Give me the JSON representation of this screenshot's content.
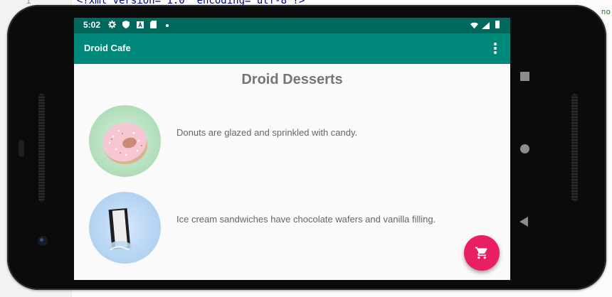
{
  "ide": {
    "line_number": "1",
    "code_line": "<?xml version=\"1.0\" encoding=\"utf-8\"?>",
    "right_fragments": [
      "no",
      "",
      ""
    ]
  },
  "status_bar": {
    "time": "5:02",
    "icons": [
      "gear-icon",
      "shield-icon",
      "a-icon",
      "sd-card-icon",
      "dot-icon",
      "wifi-icon",
      "signal-icon",
      "battery-icon"
    ]
  },
  "app_bar": {
    "title": "Droid Cafe",
    "overflow_icon": "more-vert-icon"
  },
  "main": {
    "heading": "Droid Desserts",
    "items": [
      {
        "image": "donut",
        "description": "Donuts are glazed and sprinkled with candy."
      },
      {
        "image": "ice-cream-sandwich",
        "description": "Ice cream sandwiches have chocolate wafers and vanilla filling."
      }
    ]
  },
  "fab": {
    "icon": "shopping-cart-icon"
  },
  "navigation": [
    "recents-square-icon",
    "home-circle-icon",
    "back-triangle-icon"
  ],
  "colors": {
    "status_bar": "#00695c",
    "app_bar": "#00897b",
    "fab": "#e91e63",
    "heading": "#757575",
    "body_text": "#666666"
  }
}
